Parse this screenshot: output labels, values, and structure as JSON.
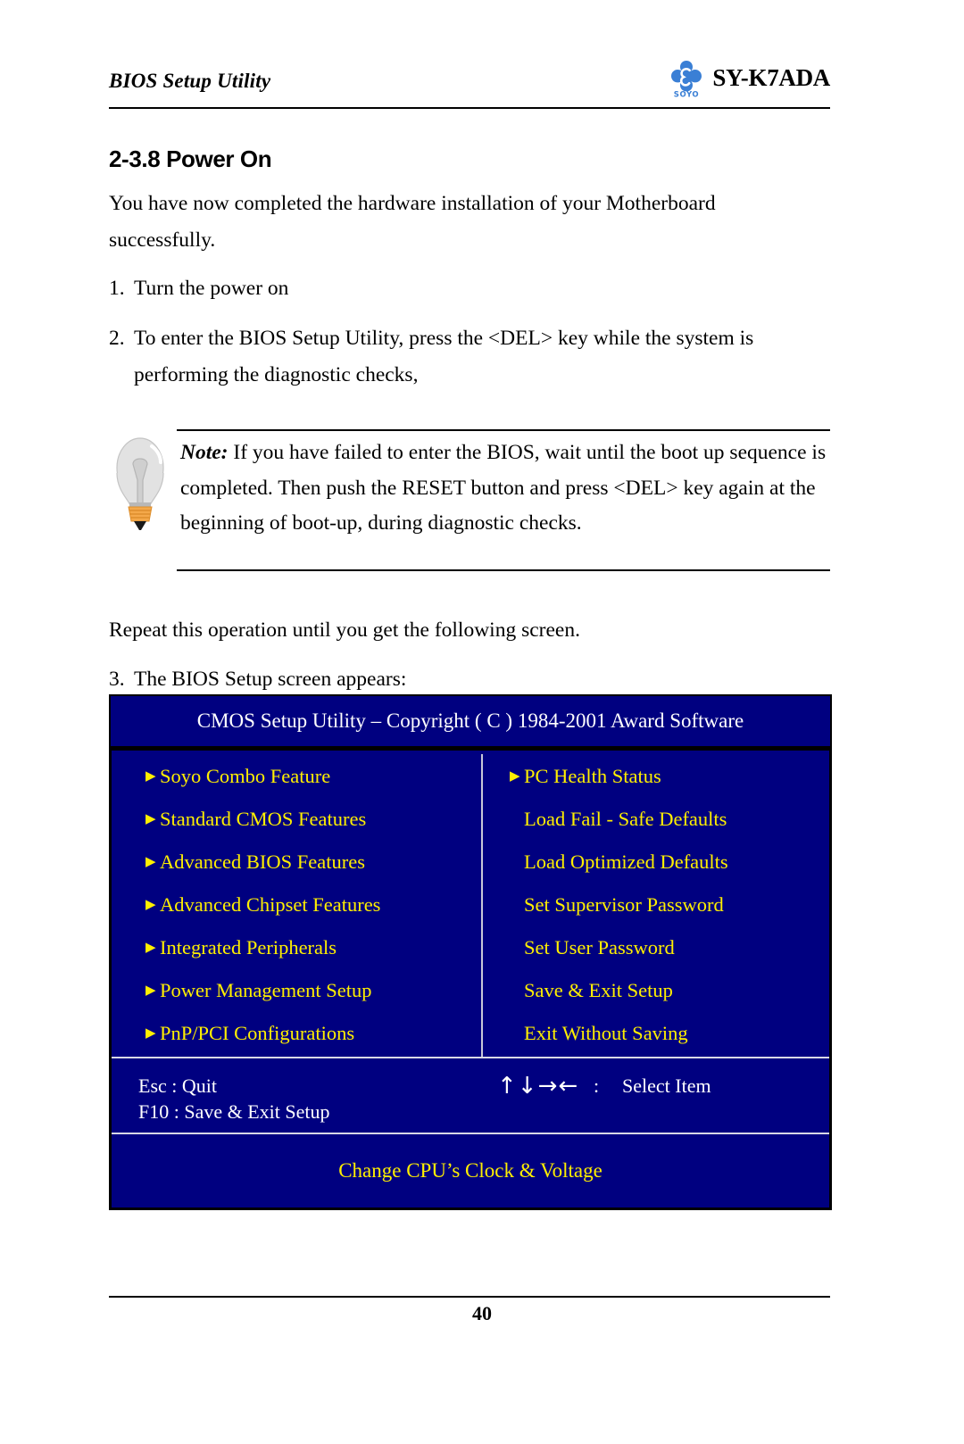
{
  "header": {
    "title": "BIOS Setup Utility",
    "model": "SY-K7ADA",
    "logo_text": "SOYO"
  },
  "section": {
    "number": "2-3.8",
    "heading": "2-3.8 Power On"
  },
  "body": {
    "intro": "You have now completed the hardware installation of your Motherboard successfully.",
    "steps": [
      {
        "num": "1.",
        "text": "Turn the power on"
      },
      {
        "num": "2.",
        "text": "To enter the BIOS Setup Utility, press the <DEL> key while the system is performing the diagnostic checks,"
      },
      {
        "num": "3.",
        "text": "The BIOS Setup screen appears:"
      }
    ],
    "repeat": "Repeat this operation until you get the following screen."
  },
  "note": {
    "label": "Note:",
    "text": " If you have failed to enter the BIOS, wait until the boot up sequence is completed. Then push the RESET button and press <DEL> key again at the beginning of boot-up, during diagnostic checks.",
    "icon": "lightbulb-icon"
  },
  "bios": {
    "titlebar": "CMOS Setup Utility – Copyright ( C ) 1984-2001 Award Software",
    "left_column": [
      {
        "label": "Soyo Combo Feature",
        "bullet": true
      },
      {
        "label": "Standard CMOS Features",
        "bullet": true
      },
      {
        "label": "Advanced BIOS Features",
        "bullet": true
      },
      {
        "label": "Advanced Chipset Features",
        "bullet": true
      },
      {
        "label": "Integrated Peripherals",
        "bullet": true
      },
      {
        "label": "Power Management Setup",
        "bullet": true
      },
      {
        "label": "PnP/PCI Configurations",
        "bullet": true
      }
    ],
    "right_column": [
      {
        "label": "PC Health Status",
        "bullet": true
      },
      {
        "label": "Load Fail - Safe Defaults",
        "bullet": false
      },
      {
        "label": "Load Optimized Defaults",
        "bullet": false
      },
      {
        "label": "Set Supervisor Password",
        "bullet": false
      },
      {
        "label": "Set User Password",
        "bullet": false
      },
      {
        "label": "Save & Exit Setup",
        "bullet": false
      },
      {
        "label": "Exit Without Saving",
        "bullet": false
      }
    ],
    "keys": {
      "left": "Esc : Quit\nF10 : Save & Exit Setup",
      "arrows": "↑↓→←",
      "separator": ":",
      "action": "Select Item"
    },
    "hint": "Change CPU’s Clock & Voltage",
    "colors": {
      "background": "#000080",
      "menu_text": "#FFEF00",
      "key_text": "#FFFFFF",
      "border": "#000000"
    }
  },
  "footer": {
    "page_number": "40"
  }
}
